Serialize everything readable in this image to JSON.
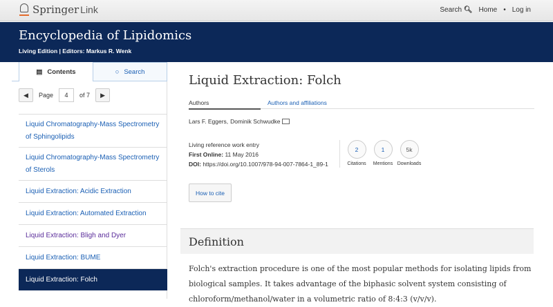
{
  "header": {
    "logo_springer": "Springer",
    "logo_link": "Link",
    "search_label": "Search",
    "home": "Home",
    "login": "Log in"
  },
  "book": {
    "title": "Encyclopedia of Lipidomics",
    "subtitle": "Living Edition | Editors: Markus R. Wenk"
  },
  "sidebar": {
    "tab_contents": "Contents",
    "tab_search": "Search",
    "page_label": "Page",
    "page_value": "4",
    "of_label": "of 7",
    "items": [
      {
        "label": "Liquid Chromatography-Mass Spectrometry of Sphingolipids"
      },
      {
        "label": "Liquid Chromatography-Mass Spectrometry of Sterols"
      },
      {
        "label": "Liquid Extraction: Acidic Extraction"
      },
      {
        "label": "Liquid Extraction: Automated Extraction"
      },
      {
        "label": "Liquid Extraction: Bligh and Dyer"
      },
      {
        "label": "Liquid Extraction: BUME"
      },
      {
        "label": "Liquid Extraction: Folch"
      }
    ]
  },
  "article": {
    "title": "Liquid Extraction: Folch",
    "tab_authors": "Authors",
    "tab_affiliations": "Authors and affiliations",
    "author1": "Lars F. Eggers,",
    "author2": "Dominik Schwudke",
    "type": "Living reference work entry",
    "first_online_label": "First Online:",
    "first_online": "11 May 2016",
    "doi_label": "DOI:",
    "doi": "https://doi.org/10.1007/978-94-007-7864-1_89-1",
    "metrics": [
      {
        "value": "2",
        "label": "Citations"
      },
      {
        "value": "1",
        "label": "Mentions"
      },
      {
        "value": "5k",
        "label": "Downloads"
      }
    ],
    "cite_button": "How to cite",
    "section_title": "Definition",
    "paragraph": "Folch's extraction procedure is one of the most popular methods for isolating lipids from biological samples. It takes advantage of the biphasic solvent system consisting of chloroform/methanol/water in a volumetric ratio of 8:4:3 (v/v/v)."
  }
}
